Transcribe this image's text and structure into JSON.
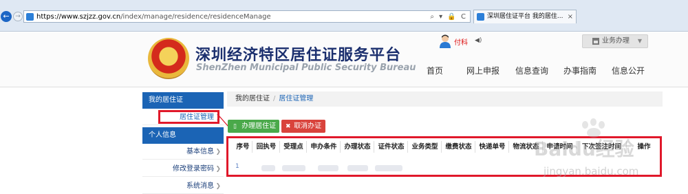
{
  "browser": {
    "url_host": "https://www.szjzz.gov.cn",
    "url_path": "/index/manage/residence/residenceManage",
    "url_controls": "⌕ ▾ 🔒 C",
    "tab_title": "深圳居住证平台 我的居住...",
    "tab_close": "×",
    "back_glyph": "←",
    "forward_glyph": "→"
  },
  "header": {
    "title": "深圳经济特区居住证服务平台",
    "subtitle": "ShenZhen Municipal Public Security Bureau",
    "user_name": "付科",
    "biz_button": "业务办理",
    "nav": [
      "首页",
      "网上申报",
      "信息查询",
      "办事指南",
      "信息公开"
    ]
  },
  "sidebar": {
    "section1": "我的居住证",
    "item_residence": "居住证管理",
    "section2": "个人信息",
    "items": [
      "基本信息",
      "修改登录密码",
      "系统消息"
    ]
  },
  "main": {
    "breadcrumb": [
      "我的居住证",
      "居住证管理"
    ],
    "apply_button": "办理居住证",
    "cancel_button": "取消办证",
    "columns": [
      "序号",
      "回执号",
      "受理点",
      "申办条件",
      "办理状态",
      "证件状态",
      "业务类型",
      "缴费状态",
      "快递单号",
      "物流状态",
      "申请时间",
      "下次签注时间",
      "操作"
    ],
    "row_first_cell": "1"
  },
  "watermark": {
    "line1": "Baidu经验",
    "line2": "jingyan.baidu.com"
  },
  "colors": {
    "brand_blue": "#1b64b5",
    "annotation_red": "#e0182a",
    "apply_green": "#4aa94a",
    "cancel_red": "#d9433c"
  }
}
